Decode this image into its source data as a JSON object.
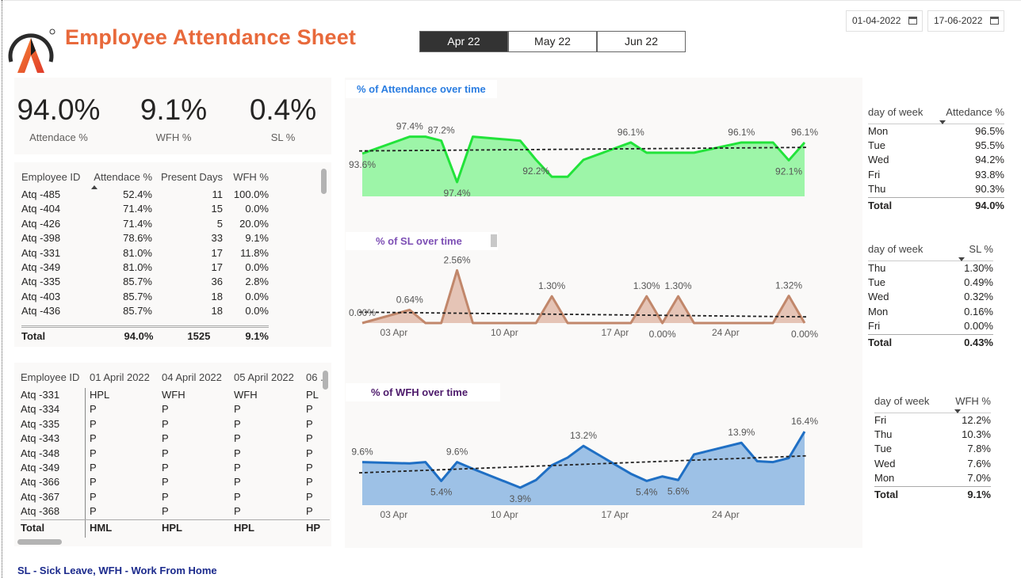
{
  "header": {
    "title": "Employee Attendance Sheet",
    "months": [
      {
        "label": "Apr 22",
        "active": true
      },
      {
        "label": "May 22",
        "active": false
      },
      {
        "label": "Jun 22",
        "active": false
      }
    ],
    "date_from": "01-04-2022",
    "date_to": "17-06-2022"
  },
  "kpis": [
    {
      "value": "94.0%",
      "label": "Attendace %"
    },
    {
      "value": "9.1%",
      "label": "WFH %"
    },
    {
      "value": "0.4%",
      "label": "SL %"
    }
  ],
  "emp_table": {
    "headers": [
      "Employee ID",
      "Attendace %",
      "Present Days",
      "WFH %"
    ],
    "rows": [
      [
        "Atq -485",
        "52.4%",
        "11",
        "100.0%"
      ],
      [
        "Atq -404",
        "71.4%",
        "15",
        "0.0%"
      ],
      [
        "Atq -426",
        "71.4%",
        "5",
        "20.0%"
      ],
      [
        "Atq -398",
        "78.6%",
        "33",
        "9.1%"
      ],
      [
        "Atq -331",
        "81.0%",
        "17",
        "11.8%"
      ],
      [
        "Atq -349",
        "81.0%",
        "17",
        "0.0%"
      ],
      [
        "Atq -335",
        "85.7%",
        "36",
        "2.8%"
      ],
      [
        "Atq -403",
        "85.7%",
        "18",
        "0.0%"
      ],
      [
        "Atq -436",
        "85.7%",
        "18",
        "0.0%"
      ]
    ],
    "total": [
      "Total",
      "94.0%",
      "1525",
      "9.1%"
    ]
  },
  "daily_table": {
    "headers": [
      "Employee ID",
      "01 April 2022",
      "04 April 2022",
      "05 April 2022",
      "06 ."
    ],
    "rows": [
      [
        "Atq -331",
        "HPL",
        "WFH",
        "WFH",
        "PL"
      ],
      [
        "Atq -334",
        "P",
        "P",
        "P",
        "P"
      ],
      [
        "Atq -335",
        "P",
        "P",
        "P",
        "P"
      ],
      [
        "Atq -343",
        "P",
        "P",
        "P",
        "P"
      ],
      [
        "Atq -348",
        "P",
        "P",
        "P",
        "P"
      ],
      [
        "Atq -349",
        "P",
        "P",
        "P",
        "P"
      ],
      [
        "Atq -366",
        "P",
        "P",
        "P",
        "P"
      ],
      [
        "Atq -367",
        "P",
        "P",
        "P",
        "P"
      ],
      [
        "Atq -368",
        "P",
        "P",
        "P",
        "P"
      ]
    ],
    "total": [
      "Total",
      "HML",
      "HPL",
      "HPL",
      "HP"
    ]
  },
  "chart_titles": {
    "attendance": "% of Attendance over time",
    "sl": "% of SL over time",
    "wfh": "% of WFH over time"
  },
  "x_ticks": [
    "03 Apr",
    "10 Apr",
    "17 Apr",
    "24 Apr"
  ],
  "chart_data": [
    {
      "type": "area",
      "title": "% of Attendance over time",
      "x": [
        "2022-04-01",
        "2022-04-04",
        "2022-04-05",
        "2022-04-06",
        "2022-04-07",
        "2022-04-08",
        "2022-04-11",
        "2022-04-12",
        "2022-04-13",
        "2022-04-14",
        "2022-04-15",
        "2022-04-18",
        "2022-04-19",
        "2022-04-20",
        "2022-04-21",
        "2022-04-22",
        "2022-04-25",
        "2022-04-26",
        "2022-04-27",
        "2022-04-28",
        "2022-04-29"
      ],
      "values": [
        93.6,
        97.4,
        97.4,
        96.5,
        87.2,
        97.4,
        96.5,
        92.2,
        88.4,
        88.4,
        92.2,
        96.1,
        93.8,
        93.8,
        93.8,
        93.8,
        96.1,
        96.1,
        96.1,
        92.1,
        96.1
      ],
      "data_labels": [
        {
          "x": "2022-04-01",
          "text": "93.6%"
        },
        {
          "x": "2022-04-04",
          "text": "97.4%"
        },
        {
          "x": "2022-04-06",
          "text": "87.2%"
        },
        {
          "x": "2022-04-07",
          "text": "97.4%"
        },
        {
          "x": "2022-04-12",
          "text": "92.2%"
        },
        {
          "x": "2022-04-18",
          "text": "96.1%"
        },
        {
          "x": "2022-04-25",
          "text": "96.1%"
        },
        {
          "x": "2022-04-28",
          "text": "92.1%"
        },
        {
          "x": "2022-04-29",
          "text": "96.1%"
        }
      ],
      "trend": [
        94.2,
        95.0
      ],
      "ylim": [
        84,
        100
      ],
      "color": "#22e33a",
      "fill": "#9df5a8"
    },
    {
      "type": "area",
      "title": "% of SL over time",
      "x": [
        "2022-04-01",
        "2022-04-04",
        "2022-04-05",
        "2022-04-06",
        "2022-04-07",
        "2022-04-08",
        "2022-04-11",
        "2022-04-12",
        "2022-04-13",
        "2022-04-14",
        "2022-04-15",
        "2022-04-18",
        "2022-04-19",
        "2022-04-20",
        "2022-04-21",
        "2022-04-22",
        "2022-04-25",
        "2022-04-26",
        "2022-04-27",
        "2022-04-28",
        "2022-04-29"
      ],
      "values": [
        0.0,
        0.64,
        0.0,
        0.0,
        2.56,
        0.0,
        0.0,
        0.0,
        1.3,
        0.0,
        0.0,
        0.0,
        1.3,
        0.0,
        1.3,
        0.0,
        0.0,
        0.0,
        0.0,
        1.32,
        0.0
      ],
      "data_labels": [
        {
          "x": "2022-04-01",
          "text": "0.00%"
        },
        {
          "x": "2022-04-04",
          "text": "0.64%"
        },
        {
          "x": "2022-04-07",
          "text": "2.56%"
        },
        {
          "x": "2022-04-13",
          "text": "1.30%"
        },
        {
          "x": "2022-04-19",
          "text": "1.30%"
        },
        {
          "x": "2022-04-20",
          "text": "0.00%"
        },
        {
          "x": "2022-04-21",
          "text": "1.30%"
        },
        {
          "x": "2022-04-28",
          "text": "1.32%"
        },
        {
          "x": "2022-04-29",
          "text": "0.00%"
        }
      ],
      "trend": [
        0.53,
        0.3
      ],
      "ylim": [
        0,
        3
      ],
      "color": "#c1876b",
      "fill": "#e5c4b6"
    },
    {
      "type": "area",
      "title": "% of WFH over time",
      "x": [
        "2022-04-01",
        "2022-04-04",
        "2022-04-05",
        "2022-04-06",
        "2022-04-07",
        "2022-04-08",
        "2022-04-11",
        "2022-04-12",
        "2022-04-13",
        "2022-04-14",
        "2022-04-15",
        "2022-04-18",
        "2022-04-19",
        "2022-04-20",
        "2022-04-21",
        "2022-04-22",
        "2022-04-25",
        "2022-04-26",
        "2022-04-27",
        "2022-04-28",
        "2022-04-29"
      ],
      "values": [
        9.6,
        9.3,
        9.6,
        5.4,
        9.6,
        8.1,
        3.9,
        5.6,
        8.9,
        10.6,
        13.2,
        7.0,
        5.4,
        6.4,
        5.6,
        11.3,
        13.9,
        9.8,
        9.6,
        10.5,
        16.4
      ],
      "data_labels": [
        {
          "x": "2022-04-01",
          "text": "9.6%"
        },
        {
          "x": "2022-04-06",
          "text": "5.4%"
        },
        {
          "x": "2022-04-07",
          "text": "9.6%"
        },
        {
          "x": "2022-04-11",
          "text": "3.9%"
        },
        {
          "x": "2022-04-15",
          "text": "13.2%"
        },
        {
          "x": "2022-04-19",
          "text": "5.4%"
        },
        {
          "x": "2022-04-21",
          "text": "5.6%"
        },
        {
          "x": "2022-04-25",
          "text": "13.9%"
        },
        {
          "x": "2022-04-29",
          "text": "16.4%"
        }
      ],
      "trend": [
        7.2,
        11.0
      ],
      "ylim": [
        0,
        18
      ],
      "color": "#1f6fc4",
      "fill": "#9dc1e6"
    }
  ],
  "dow_attendance": {
    "headers": [
      "day of week",
      "Attedance %"
    ],
    "rows": [
      [
        "Mon",
        "96.5%"
      ],
      [
        "Tue",
        "95.5%"
      ],
      [
        "Wed",
        "94.2%"
      ],
      [
        "Fri",
        "93.8%"
      ],
      [
        "Thu",
        "90.3%"
      ]
    ],
    "total": [
      "Total",
      "94.0%"
    ]
  },
  "dow_sl": {
    "headers": [
      "day of week",
      "SL %"
    ],
    "rows": [
      [
        "Thu",
        "1.30%"
      ],
      [
        "Tue",
        "0.49%"
      ],
      [
        "Wed",
        "0.32%"
      ],
      [
        "Mon",
        "0.16%"
      ],
      [
        "Fri",
        "0.00%"
      ]
    ],
    "total": [
      "Total",
      "0.43%"
    ]
  },
  "dow_wfh": {
    "headers": [
      "day of week",
      "WFH %"
    ],
    "rows": [
      [
        "Fri",
        "12.2%"
      ],
      [
        "Thu",
        "10.3%"
      ],
      [
        "Tue",
        "7.8%"
      ],
      [
        "Wed",
        "7.6%"
      ],
      [
        "Mon",
        "7.0%"
      ]
    ],
    "total": [
      "Total",
      "9.1%"
    ]
  },
  "footer_note": "SL - Sick Leave, WFH - Work From Home"
}
